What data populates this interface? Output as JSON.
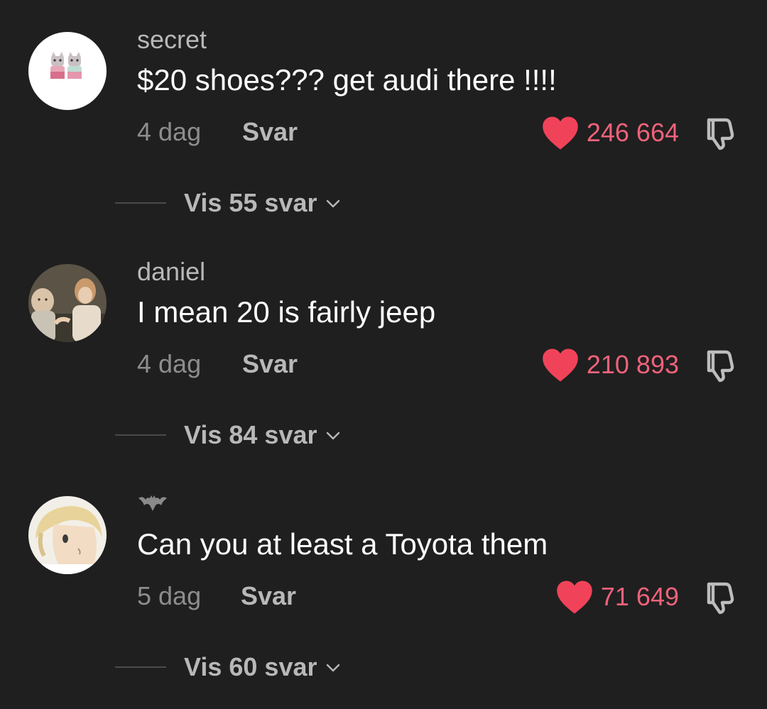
{
  "comments": [
    {
      "username": "secret",
      "text": "$20 shoes??? get audi there !!!!",
      "time": "4 dag",
      "reply_label": "Svar",
      "likes": "246 664",
      "view_replies": "Vis 55 svar"
    },
    {
      "username": "daniel",
      "text": "I mean 20 is fairly jeep",
      "time": "4 dag",
      "reply_label": "Svar",
      "likes": "210 893",
      "view_replies": "Vis 84 svar"
    },
    {
      "username_icon": "bat-icon",
      "text": "Can you at least a Toyota them",
      "time": "5 dag",
      "reply_label": "Svar",
      "likes": "71 649",
      "view_replies": "Vis 60 svar"
    }
  ],
  "colors": {
    "background": "#1f1f1f",
    "like_accent": "#f0627a",
    "text_primary": "#ffffff",
    "text_secondary": "#b8b8b8",
    "text_muted": "#8d8d8d"
  }
}
